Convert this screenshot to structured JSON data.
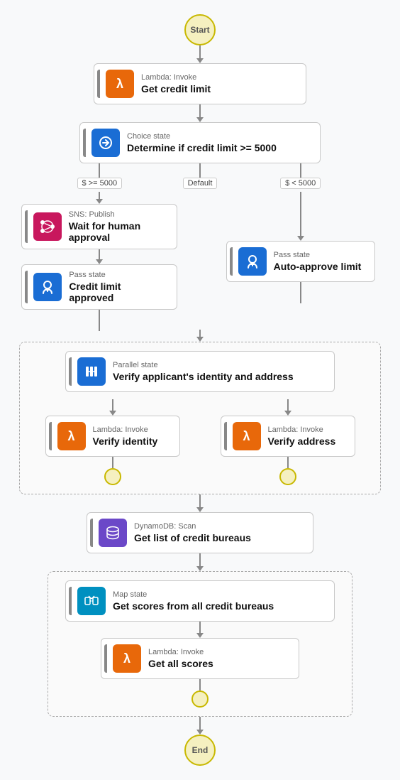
{
  "start_label": "Start",
  "end_label": "End",
  "nodes": {
    "lambda1": {
      "top_label": "Lambda: Invoke",
      "main_label": "Get credit limit",
      "icon_type": "lambda",
      "icon_color": "orange"
    },
    "choice": {
      "top_label": "Choice state",
      "main_label": "Determine if credit limit >= 5000",
      "icon_type": "choice",
      "icon_color": "blue"
    },
    "sns": {
      "top_label": "SNS: Publish",
      "main_label": "Wait for human approval",
      "icon_type": "sns",
      "icon_color": "pink"
    },
    "pass1": {
      "top_label": "Pass state",
      "main_label": "Credit limit approved",
      "icon_type": "pass",
      "icon_color": "blue"
    },
    "pass2": {
      "top_label": "Pass state",
      "main_label": "Auto-approve limit",
      "icon_type": "pass",
      "icon_color": "blue"
    },
    "parallel": {
      "top_label": "Parallel state",
      "main_label": "Verify applicant's identity and address",
      "icon_type": "parallel",
      "icon_color": "blue"
    },
    "lambda_identity": {
      "top_label": "Lambda: Invoke",
      "main_label": "Verify identity",
      "icon_type": "lambda",
      "icon_color": "orange"
    },
    "lambda_address": {
      "top_label": "Lambda: Invoke",
      "main_label": "Verify address",
      "icon_type": "lambda",
      "icon_color": "orange"
    },
    "dynamo": {
      "top_label": "DynamoDB: Scan",
      "main_label": "Get list of credit bureaus",
      "icon_type": "dynamo",
      "icon_color": "purple"
    },
    "map": {
      "top_label": "Map state",
      "main_label": "Get scores from all credit bureaus",
      "icon_type": "map",
      "icon_color": "cyan"
    },
    "lambda_scores": {
      "top_label": "Lambda: Invoke",
      "main_label": "Get all scores",
      "icon_type": "lambda",
      "icon_color": "orange"
    }
  },
  "branch_labels": {
    "gte5000": "$ >= 5000",
    "default": "Default",
    "lt5000": "$ < 5000"
  },
  "colors": {
    "orange": "#e8680a",
    "pink": "#c8175d",
    "blue": "#1a6dd4",
    "purple": "#6b48c8",
    "cyan": "#0090c0",
    "teal": "#00897b",
    "bar": "#1a6dd4",
    "connector": "#888",
    "start_fill": "#f5f0c0",
    "start_border": "#c8b800"
  }
}
